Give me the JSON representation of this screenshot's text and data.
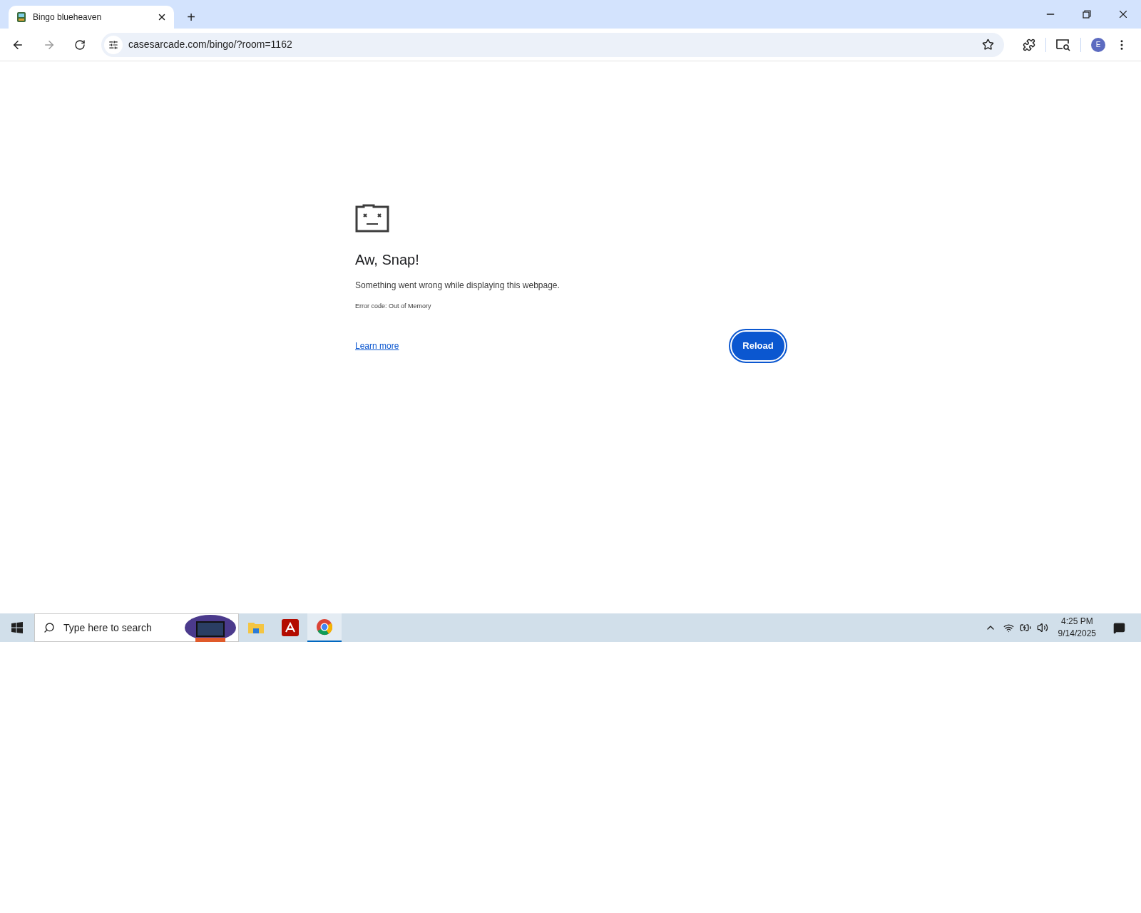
{
  "tabs": [
    {
      "title": "Bingo blueheaven",
      "selected": true
    }
  ],
  "new_tab": "+",
  "address_bar": {
    "url": "casesarcade.com/bingo/?room=1162"
  },
  "profile": {
    "initial": "E"
  },
  "error_page": {
    "title": "Aw, Snap!",
    "message": "Something went wrong while displaying this webpage.",
    "error_code": "Error code: Out of Memory",
    "link": "Learn more",
    "button": "Reload"
  },
  "taskbar": {
    "search_placeholder": "Type here to search",
    "apps": [
      {
        "kind": "folder",
        "selected": false
      },
      {
        "kind": "pdf",
        "selected": false
      },
      {
        "kind": "chrome",
        "selected": true
      }
    ],
    "time": "4:25 PM",
    "date": "9/14/2025"
  }
}
